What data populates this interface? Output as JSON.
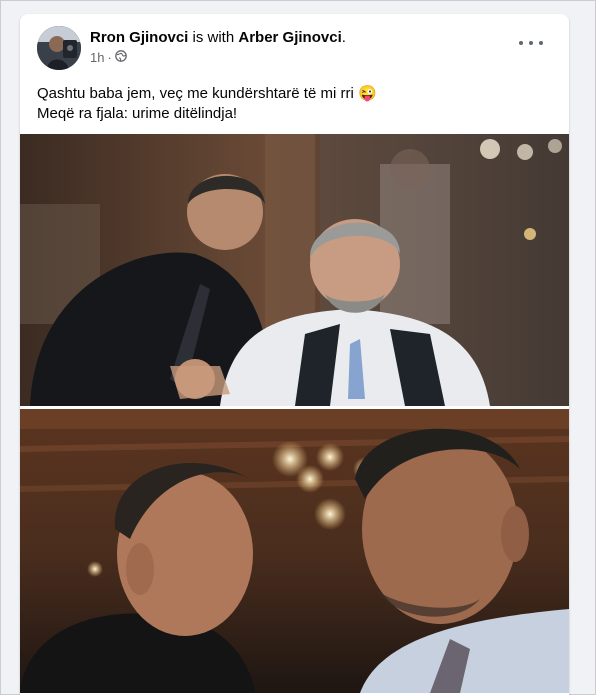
{
  "post": {
    "author": "Rron Gjinovci",
    "with_text": "is with",
    "tagged": "Arber Gjinovci",
    "period": ".",
    "time": "1h",
    "dot": "·",
    "privacy_icon": "globe-icon",
    "more_icon": "more-options-icon",
    "line1": "Qashtu baba jem, veç me kundërshtarë të mi rri",
    "emoji": "😜",
    "line2": "Meqë ra fjala: urime ditëlindja!"
  },
  "colors": {
    "background": "#f0f2f5",
    "card": "#ffffff",
    "text": "#050505",
    "secondary_text": "#65676b"
  }
}
